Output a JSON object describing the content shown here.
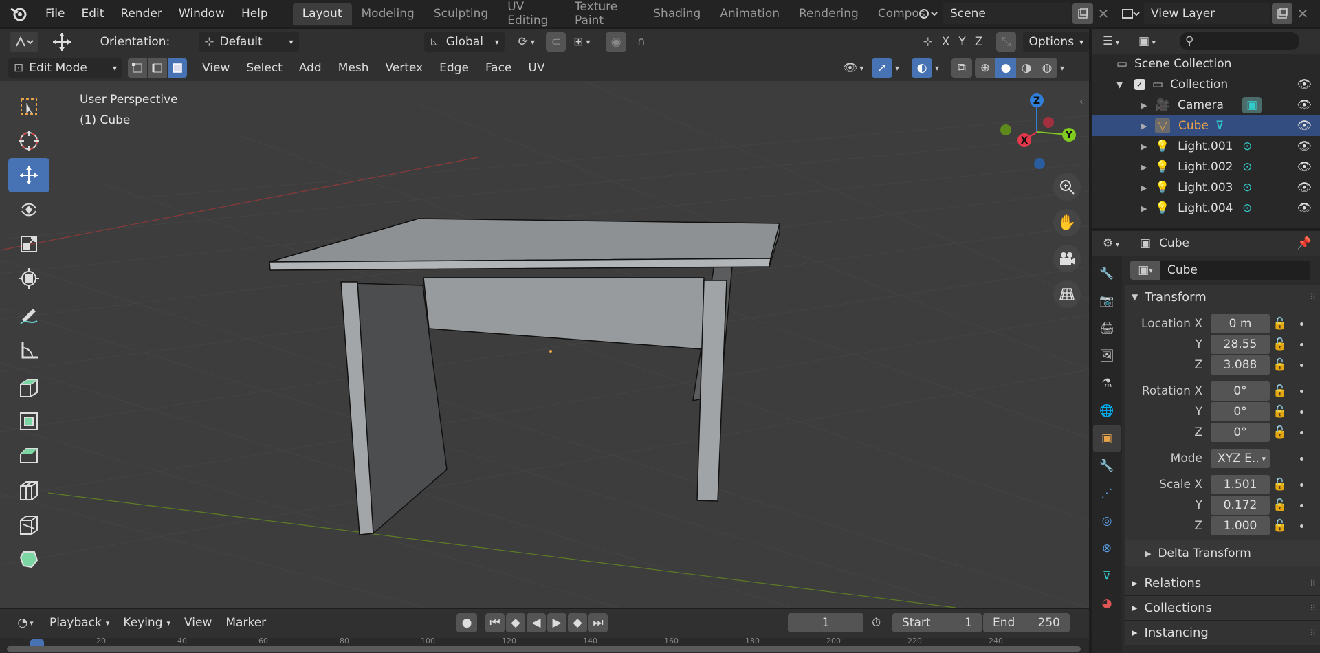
{
  "topbar": {
    "menus": [
      "File",
      "Edit",
      "Render",
      "Window",
      "Help"
    ],
    "workspaces": [
      "Layout",
      "Modeling",
      "Sculpting",
      "UV Editing",
      "Texture Paint",
      "Shading",
      "Animation",
      "Rendering",
      "Compos"
    ],
    "scene": "Scene",
    "view_layer": "View Layer"
  },
  "viewport_header": {
    "orientation_label": "Orientation:",
    "orientation_value": "Default",
    "transform_orientation": "Global",
    "axes": [
      "X",
      "Y",
      "Z"
    ],
    "options_label": "Options",
    "mode": "Edit Mode",
    "menus": [
      "View",
      "Select",
      "Add",
      "Mesh",
      "Vertex",
      "Edge",
      "Face",
      "UV"
    ]
  },
  "viewport": {
    "perspective": "User Perspective",
    "object": "(1) Cube",
    "gizmo": {
      "x": "X",
      "y": "Y",
      "z": "Z"
    }
  },
  "tools": [
    "select-box",
    "cursor",
    "move",
    "rotate",
    "scale",
    "transform",
    "annotate",
    "measure",
    "extrude",
    "inset",
    "bevel",
    "loop-cut",
    "knife",
    "poly-build"
  ],
  "outliner": {
    "root": "Scene Collection",
    "collection": "Collection",
    "items": [
      {
        "name": "Camera",
        "selected": false
      },
      {
        "name": "Cube",
        "selected": true
      },
      {
        "name": "Light.001",
        "selected": false
      },
      {
        "name": "Light.002",
        "selected": false
      },
      {
        "name": "Light.003",
        "selected": false
      },
      {
        "name": "Light.004",
        "selected": false
      }
    ]
  },
  "properties": {
    "object_name": "Cube",
    "data_name": "Cube",
    "transform_label": "Transform",
    "location": {
      "label": "Location X",
      "x": "0 m",
      "y": "28.55",
      "z": "3.088"
    },
    "rotation": {
      "label": "Rotation X",
      "x": "0°",
      "y": "0°",
      "z": "0°"
    },
    "mode": {
      "label": "Mode",
      "value": "XYZ E.."
    },
    "scale": {
      "label": "Scale X",
      "x": "1.501",
      "y": "0.172",
      "z": "1.000"
    },
    "axis_y": "Y",
    "axis_z": "Z",
    "delta_transform": "Delta Transform",
    "panels": [
      "Relations",
      "Collections",
      "Instancing"
    ]
  },
  "timeline": {
    "menus": [
      "Playback",
      "Keying",
      "View",
      "Marker"
    ],
    "current_frame": "1",
    "start_label": "Start",
    "start": "1",
    "end_label": "End",
    "end": "250",
    "ruler": [
      "20",
      "40",
      "60",
      "80",
      "100",
      "120",
      "140",
      "160",
      "180",
      "200",
      "220",
      "240"
    ]
  },
  "colors": {
    "accent": "#4772b3",
    "selected_object": "#e8a34a",
    "x_axis": "#e3374b",
    "y_axis": "#80c91e",
    "z_axis": "#2f7fdb"
  }
}
